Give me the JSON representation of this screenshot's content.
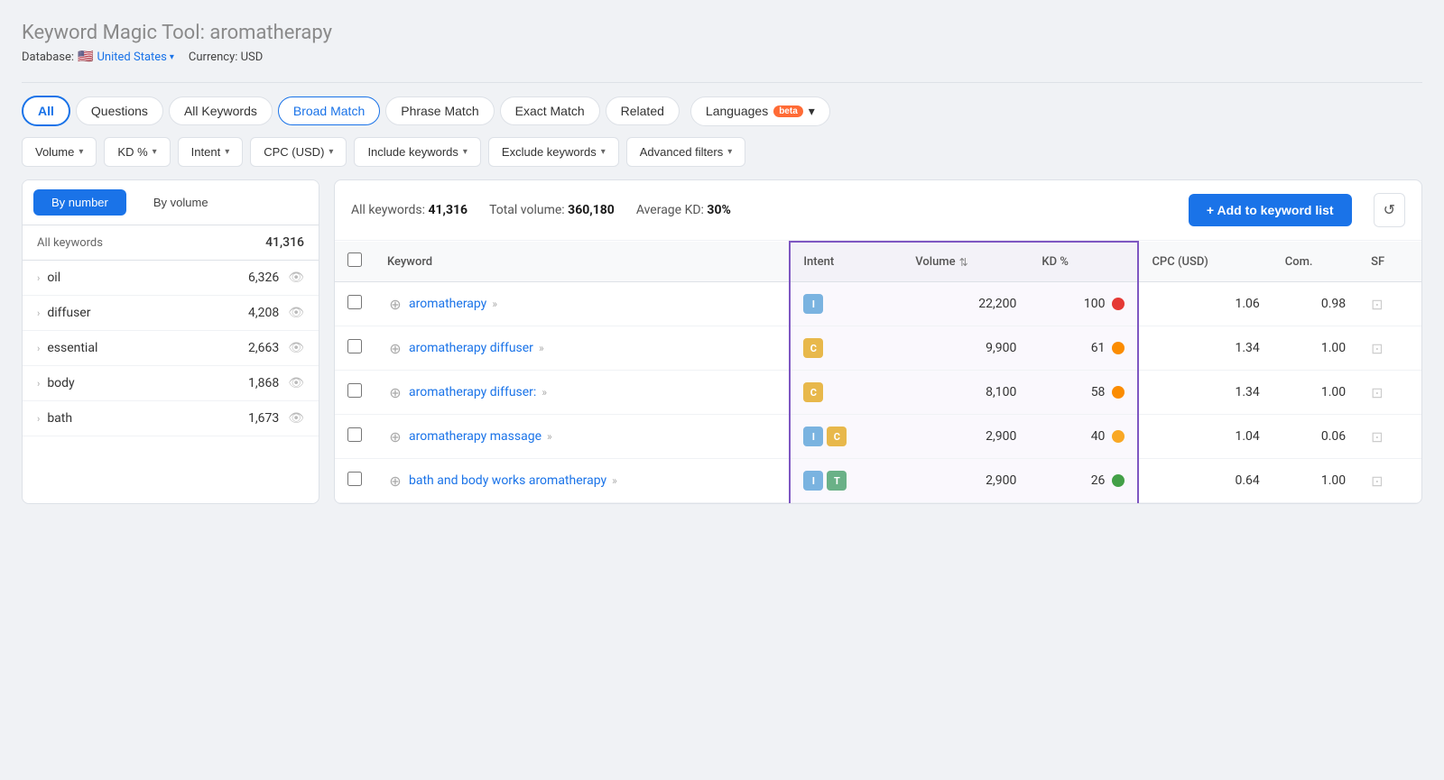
{
  "header": {
    "title": "Keyword Magic Tool:",
    "keyword": "aromatherapy",
    "db_label": "Database:",
    "db_value": "United States",
    "currency_label": "Currency: USD"
  },
  "tabs": [
    {
      "id": "all",
      "label": "All",
      "active": true
    },
    {
      "id": "questions",
      "label": "Questions",
      "active": false
    },
    {
      "id": "all-keywords",
      "label": "All Keywords",
      "active": false
    },
    {
      "id": "broad-match",
      "label": "Broad Match",
      "active": true
    },
    {
      "id": "phrase-match",
      "label": "Phrase Match",
      "active": false
    },
    {
      "id": "exact-match",
      "label": "Exact Match",
      "active": false
    },
    {
      "id": "related",
      "label": "Related",
      "active": false
    }
  ],
  "languages_btn": "Languages",
  "beta_label": "beta",
  "filters": [
    {
      "id": "volume",
      "label": "Volume"
    },
    {
      "id": "kd",
      "label": "KD %"
    },
    {
      "id": "intent",
      "label": "Intent"
    },
    {
      "id": "cpc",
      "label": "CPC (USD)"
    },
    {
      "id": "include",
      "label": "Include keywords"
    },
    {
      "id": "exclude",
      "label": "Exclude keywords"
    },
    {
      "id": "advanced",
      "label": "Advanced filters"
    }
  ],
  "sidebar": {
    "toggle_by_number": "By number",
    "toggle_by_volume": "By volume",
    "header_label": "All keywords",
    "header_count": "41,316",
    "rows": [
      {
        "keyword": "oil",
        "count": "6,326"
      },
      {
        "keyword": "diffuser",
        "count": "4,208"
      },
      {
        "keyword": "essential",
        "count": "2,663"
      },
      {
        "keyword": "body",
        "count": "1,868"
      },
      {
        "keyword": "bath",
        "count": "1,673"
      }
    ]
  },
  "stats": {
    "all_keywords_label": "All keywords:",
    "all_keywords_value": "41,316",
    "total_volume_label": "Total volume:",
    "total_volume_value": "360,180",
    "avg_kd_label": "Average KD:",
    "avg_kd_value": "30%"
  },
  "add_keyword_btn": "+ Add to keyword list",
  "table": {
    "columns": [
      "Keyword",
      "Intent",
      "Volume",
      "KD %",
      "CPC (USD)",
      "Com.",
      "SF"
    ],
    "rows": [
      {
        "keyword": "aromatherapy",
        "keyword_suffix": "»",
        "intent": [
          "I"
        ],
        "volume": "22,200",
        "kd": "100",
        "kd_color": "red",
        "cpc": "1.06",
        "com": "0.98"
      },
      {
        "keyword": "aromatherapy diffuser",
        "keyword_suffix": "»",
        "intent": [
          "C"
        ],
        "volume": "9,900",
        "kd": "61",
        "kd_color": "orange",
        "cpc": "1.34",
        "com": "1.00"
      },
      {
        "keyword": "aromatherapy diffuser:",
        "keyword_suffix": "»",
        "intent": [
          "C"
        ],
        "volume": "8,100",
        "kd": "58",
        "kd_color": "orange",
        "cpc": "1.34",
        "com": "1.00"
      },
      {
        "keyword": "aromatherapy massage",
        "keyword_suffix": "»",
        "intent": [
          "I",
          "C"
        ],
        "volume": "2,900",
        "kd": "40",
        "kd_color": "yellow",
        "cpc": "1.04",
        "com": "0.06"
      },
      {
        "keyword": "bath and body works aromatherapy",
        "keyword_suffix": "»",
        "intent": [
          "I",
          "T"
        ],
        "volume": "2,900",
        "kd": "26",
        "kd_color": "green",
        "cpc": "0.64",
        "com": "1.00"
      }
    ]
  }
}
